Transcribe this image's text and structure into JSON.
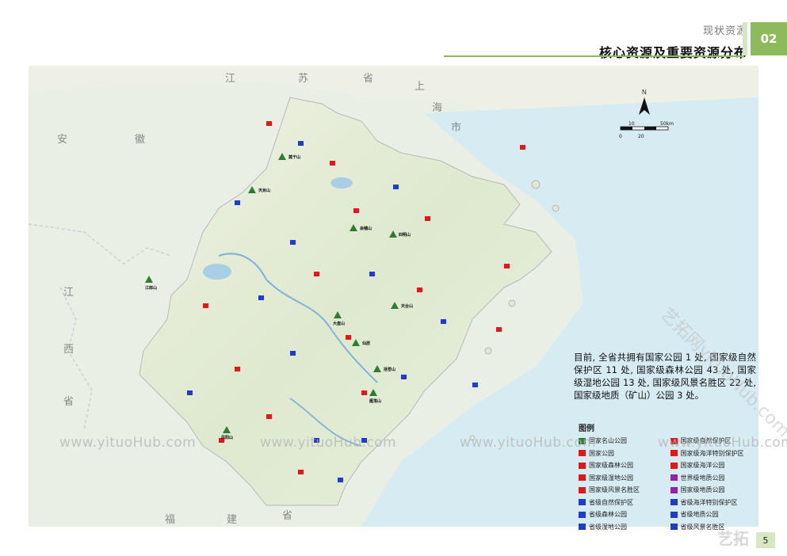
{
  "header": {
    "section": "现状资源",
    "title": "核心资源及重要资源分布",
    "tab_no": "02"
  },
  "map": {
    "province_labels": [
      "江",
      "苏",
      "省",
      "上",
      "海",
      "市",
      "安",
      "徽",
      "江",
      "西",
      "省",
      "福",
      "建",
      "省"
    ],
    "parks": [
      "莫干山",
      "天目山",
      "会稽山",
      "四明山",
      "江郎山",
      "大盘山",
      "雁荡山",
      "仙居",
      "天台山",
      "括苍山",
      "凤阳山"
    ],
    "scale": {
      "north": "N",
      "labels": [
        "10",
        "50km",
        "0",
        "20"
      ]
    }
  },
  "description": "目前, 全省共拥有国家公园 1 处, 国家级自然保护区 11 处, 国家级森林公园 43 处, 国家级湿地公园 13 处, 国家级风景名胜区 22 处, 国家级地质（矿山）公园 3 处。",
  "legend": {
    "title": "图例",
    "items": [
      {
        "label": "国家名山公园",
        "color": "#2e7d32"
      },
      {
        "label": "国家级自然保护区",
        "color": "#d81b1b"
      },
      {
        "label": "国家公园",
        "color": "#d81b1b"
      },
      {
        "label": "国家级海洋特别保护区",
        "color": "#d81b1b"
      },
      {
        "label": "国家级森林公园",
        "color": "#d81b1b"
      },
      {
        "label": "国家级海洋公园",
        "color": "#d81b1b"
      },
      {
        "label": "国家级湿地公园",
        "color": "#d81b1b"
      },
      {
        "label": "世界级地质公园",
        "color": "#8e24aa"
      },
      {
        "label": "国家级风景名胜区",
        "color": "#d81b1b"
      },
      {
        "label": "国家级地质公园",
        "color": "#8e24aa"
      },
      {
        "label": "省级自然保护区",
        "color": "#1e3fbf"
      },
      {
        "label": "省级海洋特别保护区",
        "color": "#1e3fbf"
      },
      {
        "label": "省级森林公园",
        "color": "#1e3fbf"
      },
      {
        "label": "省级地质公园",
        "color": "#1e3fbf"
      },
      {
        "label": "省级湿地公园",
        "color": "#1e3fbf"
      },
      {
        "label": "省级风景名胜区",
        "color": "#1e3fbf"
      }
    ]
  },
  "watermark": {
    "text": "www.yituoHub.com",
    "diag": "艺拓网yituoHub.com",
    "corner": "艺拓"
  },
  "page_number": "5"
}
